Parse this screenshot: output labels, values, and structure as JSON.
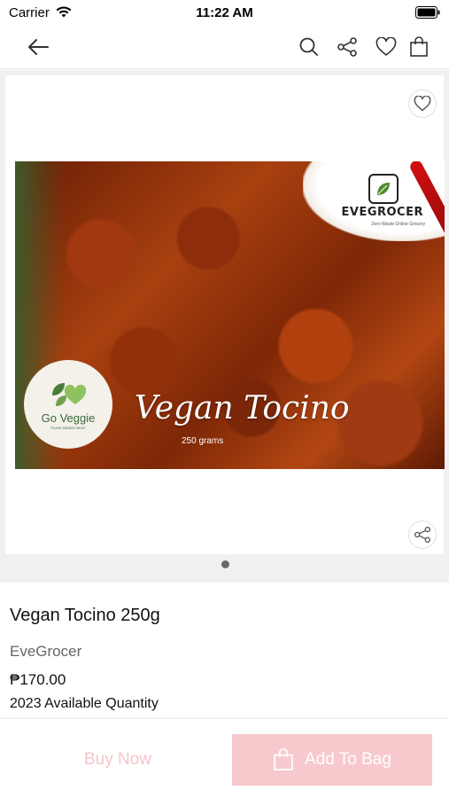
{
  "status_bar": {
    "carrier": "Carrier",
    "time": "11:22 AM"
  },
  "nav": {
    "icons": [
      "arrow-left-icon",
      "search-icon",
      "share-icon",
      "heart-icon",
      "bag-icon"
    ]
  },
  "gallery": {
    "image_text": {
      "brand_logo": "EVEGROCER",
      "brand_tagline": "Zero Waste Online Grocery",
      "partner_logo": "Go Veggie",
      "partner_tagline": "PLANT BASED MEAT",
      "overlay_title": "Vegan Tocino",
      "overlay_weight": "250 grams"
    },
    "page_count": 1,
    "current_page": 1
  },
  "product": {
    "title": "Vegan Tocino 250g",
    "seller": "EveGrocer",
    "price": "₱170.00",
    "quantity": "2023 Available Quantity"
  },
  "actions": {
    "buy_now": "Buy Now",
    "add_to_bag": "Add To Bag"
  },
  "colors": {
    "accent_pink": "#f8c9cc",
    "buy_now_text": "#f6c4c8"
  }
}
